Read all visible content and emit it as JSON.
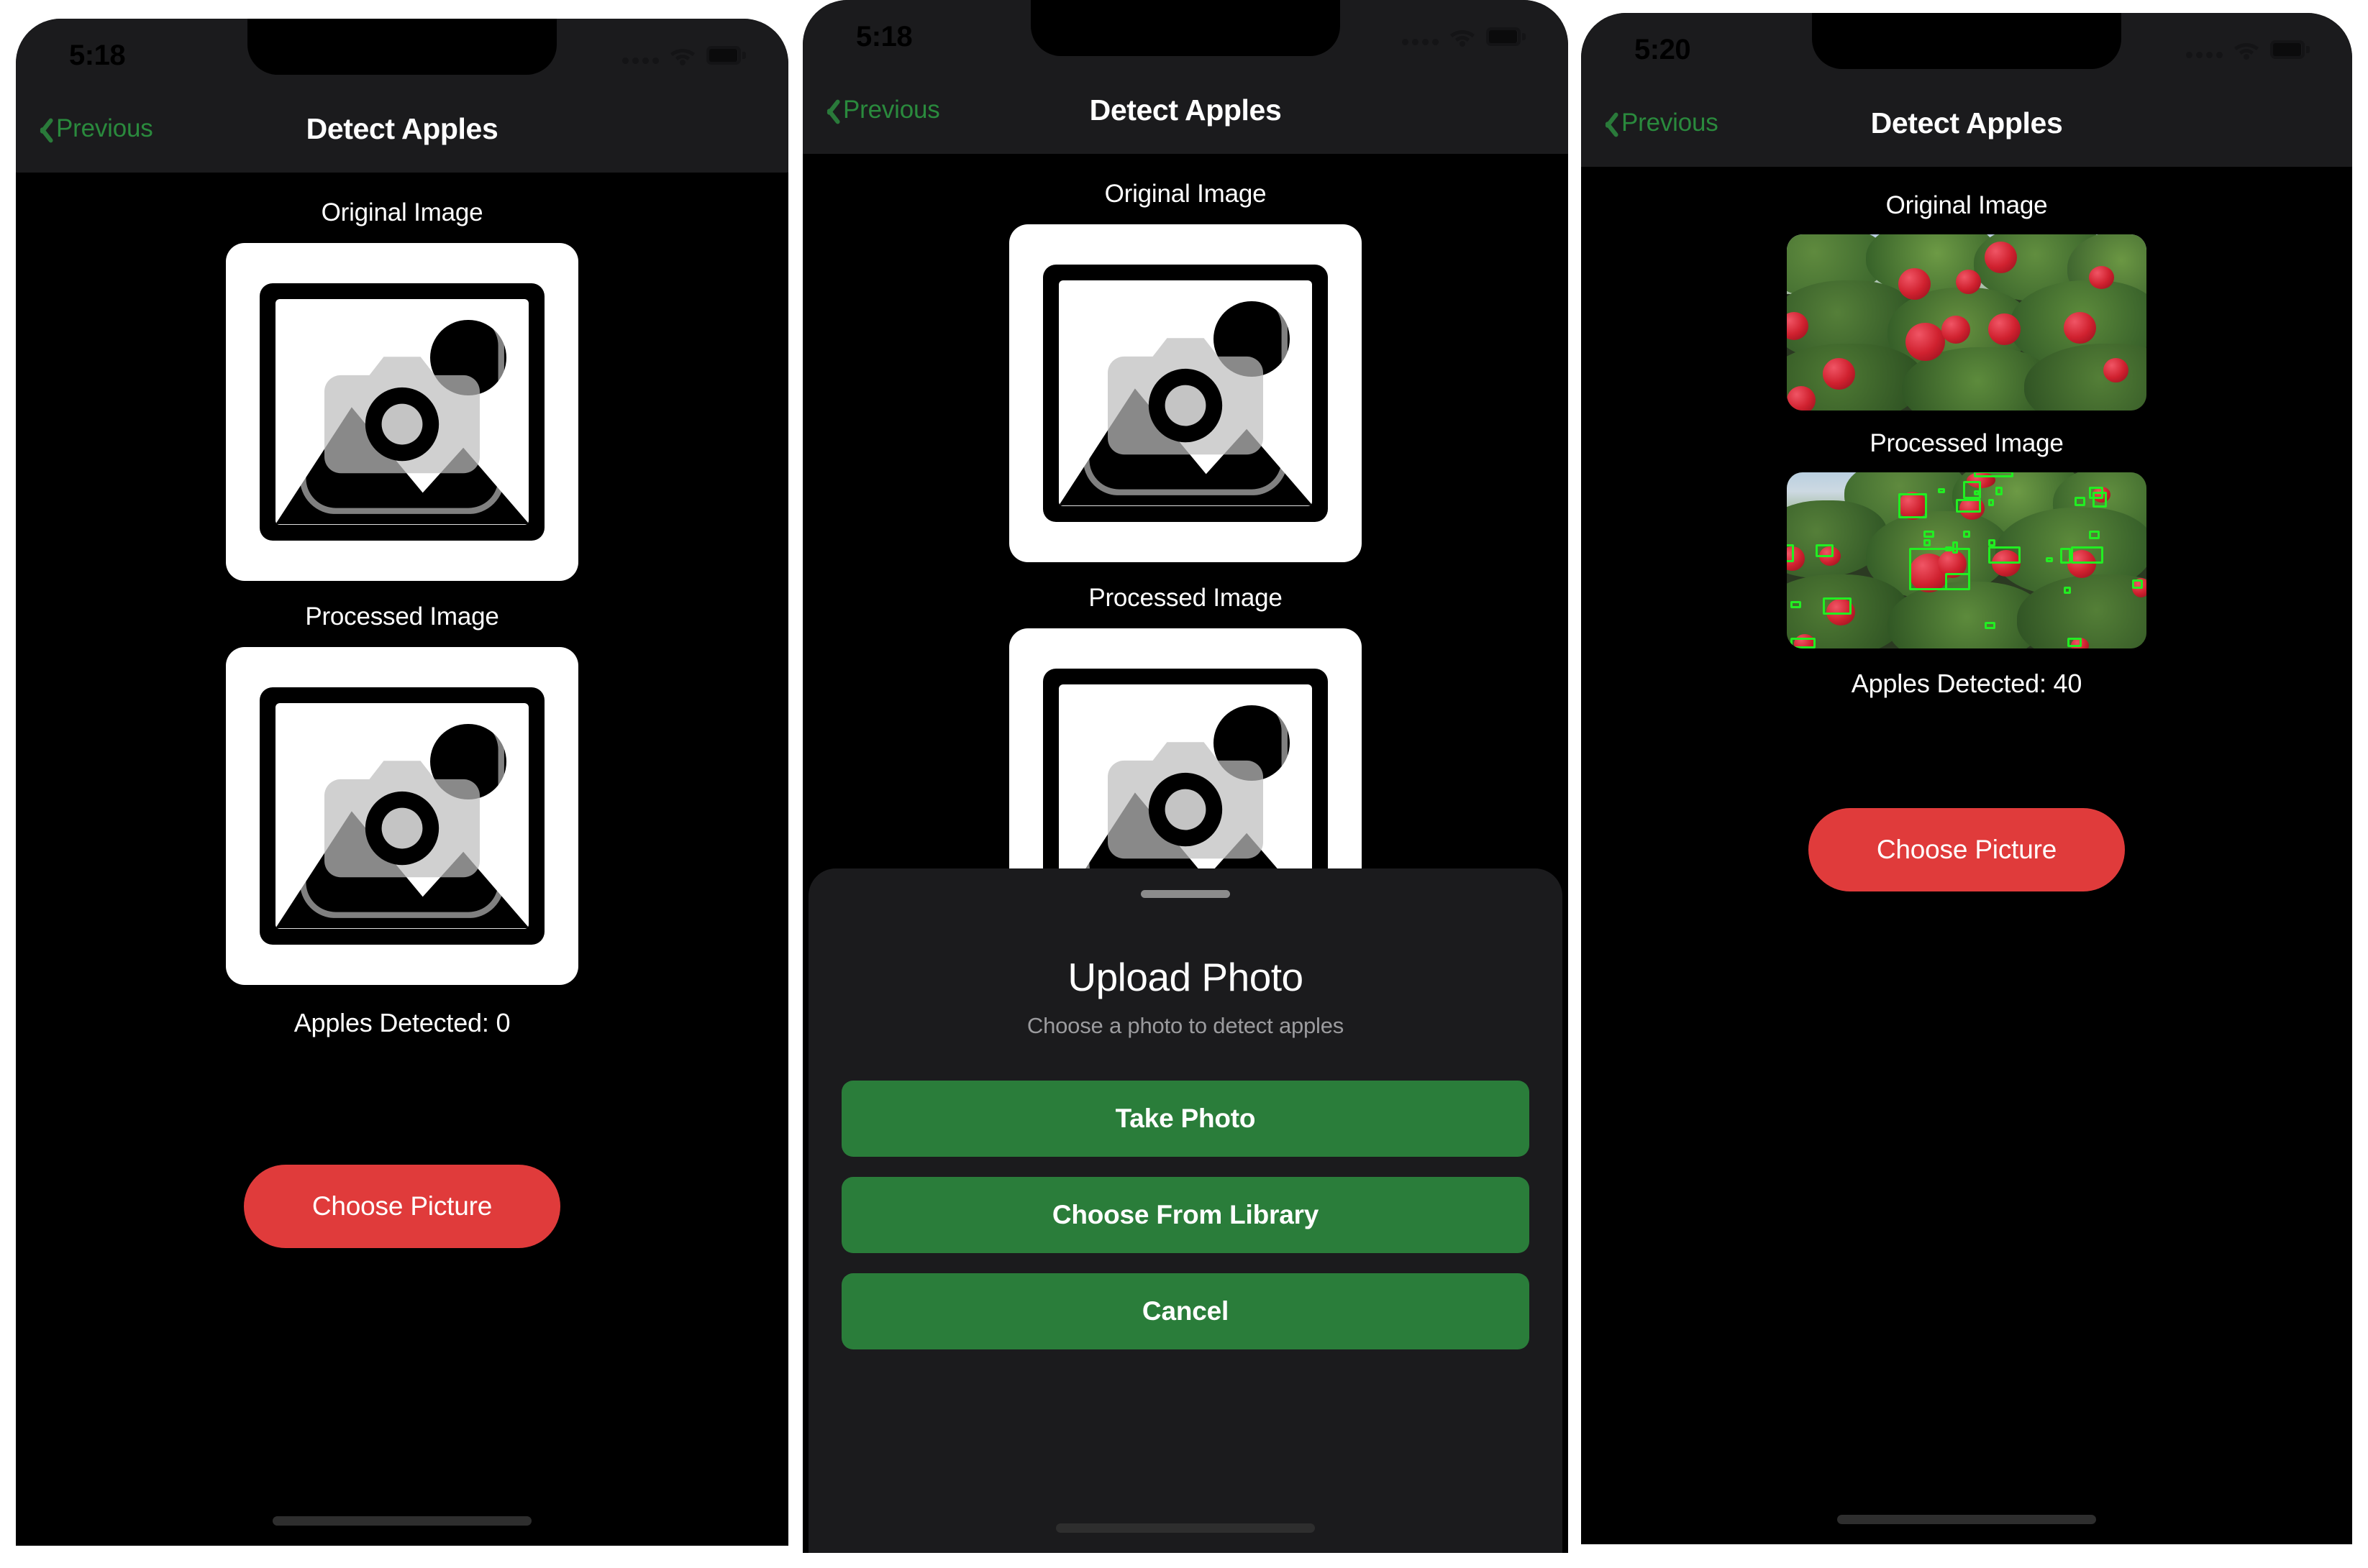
{
  "colors": {
    "accent_green": "#2a8a3d",
    "button_green": "#2a7d3a",
    "button_red": "#e03b3b",
    "background": "#000000",
    "navbar": "#1b1b1d",
    "sheet": "#1b1b1d",
    "detection_box": "#22ee22",
    "text_primary": "#ffffff",
    "text_secondary": "#9b9b9e"
  },
  "panels": [
    {
      "id": "empty-state",
      "status_bar": {
        "time": "5:18",
        "cellular_icon": "cellular-signal-icon",
        "wifi_icon": "wifi-icon",
        "battery_icon": "battery-icon"
      },
      "nav": {
        "back_label": "Previous",
        "back_icon": "chevron-left-icon",
        "title": "Detect Apples"
      },
      "original_label": "Original Image",
      "processed_label": "Processed Image",
      "original_state": "placeholder",
      "processed_state": "placeholder",
      "placeholder_icon": "photo-placeholder-icon",
      "count_label": "Apples Detected: 0",
      "primary_button": "Choose Picture",
      "home_indicator": "home-indicator",
      "sheet": null
    },
    {
      "id": "upload-sheet",
      "status_bar": {
        "time": "5:18",
        "cellular_icon": "cellular-signal-icon",
        "wifi_icon": "wifi-icon",
        "battery_icon": "battery-icon"
      },
      "nav": {
        "back_label": "Previous",
        "back_icon": "chevron-left-icon",
        "title": "Detect Apples"
      },
      "original_label": "Original Image",
      "processed_label": "Processed Image",
      "original_state": "placeholder",
      "processed_state": "placeholder",
      "placeholder_icon": "photo-placeholder-icon",
      "count_label": "",
      "primary_button": "",
      "home_indicator": "home-indicator",
      "sheet": {
        "grabber": "sheet-grabber",
        "title": "Upload Photo",
        "subtitle": "Choose a photo to detect apples",
        "buttons": [
          {
            "label": "Take Photo",
            "name": "take-photo-button"
          },
          {
            "label": "Choose From Library",
            "name": "choose-from-library-button"
          },
          {
            "label": "Cancel",
            "name": "cancel-button"
          }
        ]
      }
    },
    {
      "id": "result-state",
      "status_bar": {
        "time": "5:20",
        "cellular_icon": "cellular-signal-icon",
        "wifi_icon": "wifi-icon",
        "battery_icon": "battery-icon"
      },
      "nav": {
        "back_label": "Previous",
        "back_icon": "chevron-left-icon",
        "title": "Detect Apples"
      },
      "original_label": "Original Image",
      "processed_label": "Processed Image",
      "original_state": "photo",
      "processed_state": "photo-with-detections",
      "photo_description": "apple tree orchard with red apples among green leaves and sky",
      "count_label": "Apples Detected: 40",
      "detections_count": 40,
      "primary_button": "Choose Picture",
      "home_indicator": "home-indicator",
      "sheet": null
    }
  ]
}
